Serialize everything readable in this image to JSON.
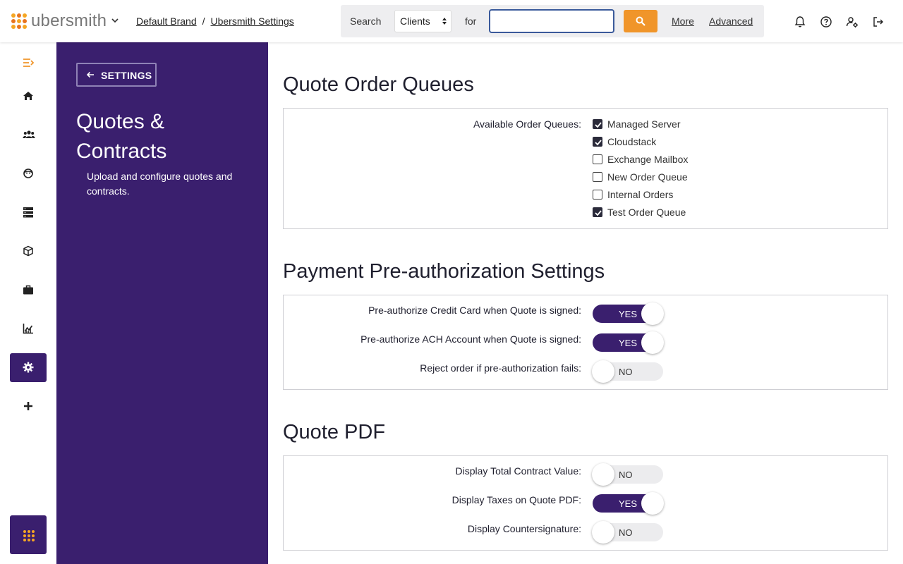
{
  "app": {
    "logo_text": "ubersmith"
  },
  "breadcrumb": {
    "brand": "Default Brand",
    "separator": "/",
    "settings": "Ubersmith Settings"
  },
  "search": {
    "label": "Search",
    "scope_selected": "Clients",
    "for_label": "for",
    "query": "",
    "more_label": "More",
    "advanced_label": "Advanced"
  },
  "header_icons": [
    "bell-icon",
    "help-icon",
    "user-settings-icon",
    "logout-icon"
  ],
  "nav": {
    "items": [
      "menu-toggle-icon",
      "home-icon",
      "clients-icon",
      "support-icon",
      "devices-icon",
      "products-icon",
      "business-icon",
      "reports-icon",
      "settings-icon",
      "add-icon"
    ],
    "active": "settings-icon"
  },
  "panel": {
    "back_label": "SETTINGS",
    "title": "Quotes & Contracts",
    "description": "Upload and configure quotes and contracts."
  },
  "sections": {
    "order_queues": {
      "title": "Quote Order Queues",
      "label": "Available Order Queues:",
      "queues": [
        {
          "name": "Managed Server",
          "checked": true
        },
        {
          "name": "Cloudstack",
          "checked": true
        },
        {
          "name": "Exchange Mailbox",
          "checked": false
        },
        {
          "name": "New Order Queue",
          "checked": false
        },
        {
          "name": "Internal Orders",
          "checked": false
        },
        {
          "name": "Test Order Queue",
          "checked": true
        }
      ]
    },
    "preauth": {
      "title": "Payment Pre-authorization Settings",
      "settings": [
        {
          "label": "Pre-authorize Credit Card when Quote is signed:",
          "value": "YES",
          "on": true
        },
        {
          "label": "Pre-authorize ACH Account when Quote is signed:",
          "value": "YES",
          "on": true
        },
        {
          "label": "Reject order if pre-authorization fails:",
          "value": "NO",
          "on": false
        }
      ]
    },
    "quote_pdf": {
      "title": "Quote PDF",
      "settings": [
        {
          "label": "Display Total Contract Value:",
          "value": "NO",
          "on": false
        },
        {
          "label": "Display Taxes on Quote PDF:",
          "value": "YES",
          "on": true
        },
        {
          "label": "Display Countersignature:",
          "value": "NO",
          "on": false
        }
      ]
    }
  },
  "colors": {
    "brand_purple": "#3a1f6e",
    "accent_orange": "#f0952a"
  }
}
